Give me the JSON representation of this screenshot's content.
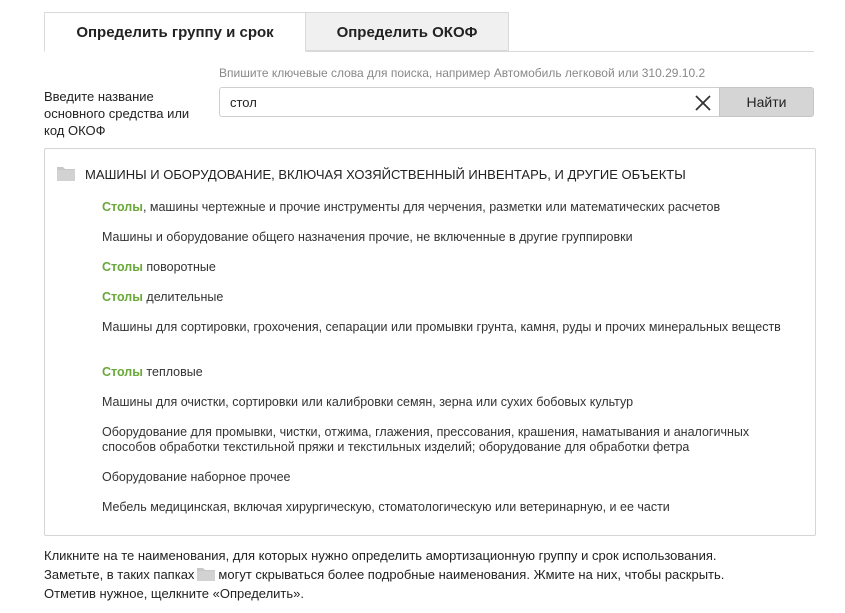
{
  "tabs": {
    "tab1_label": "Определить группу и срок",
    "tab2_label": "Определить ОКОФ"
  },
  "search": {
    "hint": "Впишите ключевые слова для поиска, например Автомобиль легковой или 310.29.10.2",
    "label": "Введите название основного средства или код ОКОФ",
    "value": "стол",
    "button_label": "Найти"
  },
  "results": {
    "folder_title": "МАШИНЫ И ОБОРУДОВАНИЕ, ВКЛЮЧАЯ ХОЗЯЙСТВЕННЫЙ ИНВЕНТАРЬ, И ДРУГИЕ ОБЪЕКТЫ",
    "items": [
      {
        "keyword": "Столы",
        "text": ", машины чертежные и прочие инструменты для черчения, разметки или математических расчетов"
      },
      {
        "keyword": "",
        "text": "Машины и оборудование общего назначения прочие, не включенные в другие группировки"
      },
      {
        "keyword": "Столы",
        "text": " поворотные"
      },
      {
        "keyword": "Столы",
        "text": " делительные"
      },
      {
        "keyword": "",
        "text": "Машины для сортировки, грохочения, сепарации или промывки грунта, камня, руды и прочих минеральных веществ"
      },
      {
        "keyword": "Столы",
        "text": " тепловые"
      },
      {
        "keyword": "",
        "text": "Машины для очистки, сортировки или калибровки семян, зерна или сухих бобовых культур"
      },
      {
        "keyword": "",
        "text": "Оборудование для промывки, чистки, отжима, глажения, прессования, крашения, наматывания и аналогичных способов обработки текстильной пряжи и текстильных изделий; оборудование для обработки фетра"
      },
      {
        "keyword": "",
        "text": "Оборудование наборное прочее"
      },
      {
        "keyword": "",
        "text": "Мебель медицинская, включая хирургическую, стоматологическую или ветеринарную, и ее части"
      }
    ]
  },
  "footer": {
    "line1": "Кликните на те наименования, для которых нужно определить амортизационную группу и срок использования.",
    "line2_before": "Заметьте, в таких папках",
    "line2_after": "могут скрываться более подробные наименования. Жмите на них, чтобы раскрыть.",
    "line3": "Отметив нужное, щелкните «Определить»."
  },
  "colors": {
    "keyword": "#6aa83a",
    "folder": "#c8c8c8",
    "button_bg": "#d5d5d5"
  },
  "icons": {
    "folder": "folder-icon",
    "clear": "close-icon"
  }
}
